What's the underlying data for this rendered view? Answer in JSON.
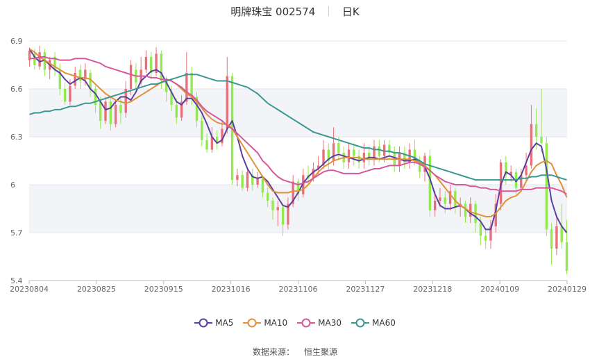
{
  "header": {
    "title": "明牌珠宝 002574",
    "period": "日K"
  },
  "source": {
    "label": "数据来源：",
    "value": "恒生聚源"
  },
  "chart_data": {
    "type": "candlestick",
    "y_ticks": [
      "6.9",
      "6.6",
      "6.3",
      "6",
      "5.7",
      "5.4"
    ],
    "y_range": [
      5.4,
      6.9
    ],
    "x_ticks": [
      "20230804",
      "20230825",
      "20230915",
      "20231016",
      "20231106",
      "20231127",
      "20231218",
      "20240109",
      "20240129"
    ],
    "grid": "horizontal, alternating shaded bands",
    "colors": {
      "up": "#e8707a",
      "down": "#92ea4e"
    },
    "legend_position": "bottom",
    "series": [
      {
        "name": "MA5",
        "color": "#5b3fa0",
        "values": [
          6.85,
          6.8,
          6.77,
          6.78,
          6.75,
          6.72,
          6.7,
          6.66,
          6.63,
          6.65,
          6.67,
          6.65,
          6.6,
          6.57,
          6.52,
          6.47,
          6.48,
          6.52,
          6.55,
          6.55,
          6.53,
          6.58,
          6.65,
          6.68,
          6.71,
          6.72,
          6.7,
          6.64,
          6.58,
          6.52,
          6.5,
          6.54,
          6.54,
          6.5,
          6.45,
          6.38,
          6.3,
          6.26,
          6.28,
          6.35,
          6.4,
          6.3,
          6.18,
          6.1,
          6.05,
          6.04,
          6.05,
          6.02,
          5.97,
          5.92,
          5.87,
          5.86,
          5.9,
          5.95,
          6.01,
          6.05,
          6.08,
          6.1,
          6.13,
          6.16,
          6.18,
          6.19,
          6.18,
          6.17,
          6.16,
          6.15,
          6.16,
          6.17,
          6.17,
          6.16,
          6.17,
          6.18,
          6.17,
          6.16,
          6.15,
          6.15,
          6.16,
          6.15,
          6.11,
          6.04,
          5.94,
          5.87,
          5.85,
          5.85,
          5.86,
          5.87,
          5.85,
          5.82,
          5.8,
          5.77,
          5.72,
          5.72,
          5.84,
          6.0,
          6.08,
          6.06,
          6.02,
          6.06,
          6.14,
          6.22,
          6.26,
          6.24,
          6.1,
          5.9,
          5.8,
          5.74,
          5.7
        ]
      },
      {
        "name": "MA10",
        "color": "#e0913a",
        "values": [
          6.85,
          6.83,
          6.8,
          6.78,
          6.76,
          6.74,
          6.72,
          6.7,
          6.69,
          6.68,
          6.67,
          6.67,
          6.66,
          6.63,
          6.6,
          6.57,
          6.55,
          6.53,
          6.52,
          6.51,
          6.52,
          6.54,
          6.56,
          6.58,
          6.6,
          6.62,
          6.64,
          6.66,
          6.65,
          6.63,
          6.6,
          6.57,
          6.55,
          6.52,
          6.48,
          6.44,
          6.41,
          6.39,
          6.38,
          6.38,
          6.35,
          6.3,
          6.25,
          6.2,
          6.15,
          6.1,
          6.05,
          6.0,
          5.96,
          5.95,
          5.95,
          5.95,
          5.96,
          5.96,
          5.97,
          6.0,
          6.04,
          6.08,
          6.11,
          6.13,
          6.15,
          6.16,
          6.17,
          6.17,
          6.17,
          6.17,
          6.16,
          6.16,
          6.16,
          6.16,
          6.16,
          6.16,
          6.16,
          6.16,
          6.16,
          6.16,
          6.15,
          6.14,
          6.12,
          6.09,
          6.06,
          6.02,
          5.98,
          5.94,
          5.9,
          5.87,
          5.85,
          5.83,
          5.82,
          5.81,
          5.8,
          5.8,
          5.82,
          5.86,
          5.9,
          5.92,
          5.93,
          5.96,
          6.02,
          6.08,
          6.12,
          6.14,
          6.15,
          6.13,
          6.06,
          6.0,
          5.92
        ]
      },
      {
        "name": "MA30",
        "color": "#d6579c",
        "values": [
          6.79,
          6.79,
          6.8,
          6.8,
          6.79,
          6.79,
          6.78,
          6.78,
          6.78,
          6.79,
          6.79,
          6.79,
          6.78,
          6.77,
          6.76,
          6.74,
          6.73,
          6.72,
          6.71,
          6.7,
          6.69,
          6.68,
          6.68,
          6.68,
          6.67,
          6.67,
          6.66,
          6.66,
          6.65,
          6.63,
          6.61,
          6.58,
          6.56,
          6.53,
          6.49,
          6.46,
          6.44,
          6.42,
          6.4,
          6.37,
          6.35,
          6.32,
          6.29,
          6.26,
          6.23,
          6.2,
          6.15,
          6.12,
          6.08,
          6.05,
          6.03,
          6.02,
          6.01,
          6.0,
          6.01,
          6.02,
          6.04,
          6.06,
          6.08,
          6.09,
          6.09,
          6.08,
          6.07,
          6.07,
          6.07,
          6.07,
          6.08,
          6.09,
          6.1,
          6.1,
          6.11,
          6.12,
          6.12,
          6.12,
          6.13,
          6.14,
          6.14,
          6.13,
          6.11,
          6.09,
          6.06,
          6.04,
          6.02,
          6.01,
          6.0,
          6.0,
          6.0,
          5.99,
          5.99,
          5.98,
          5.98,
          5.97,
          5.97,
          5.96,
          5.96,
          5.96,
          5.96,
          5.97,
          5.97,
          5.97,
          5.98,
          5.98,
          5.98,
          5.98,
          5.97,
          5.96,
          5.94
        ]
      },
      {
        "name": "MA60",
        "color": "#3a9793",
        "values": [
          6.44,
          6.45,
          6.45,
          6.46,
          6.46,
          6.47,
          6.47,
          6.48,
          6.49,
          6.49,
          6.5,
          6.51,
          6.51,
          6.52,
          6.53,
          6.54,
          6.55,
          6.56,
          6.57,
          6.58,
          6.59,
          6.6,
          6.61,
          6.62,
          6.63,
          6.63,
          6.64,
          6.65,
          6.66,
          6.67,
          6.68,
          6.69,
          6.69,
          6.69,
          6.68,
          6.67,
          6.66,
          6.65,
          6.65,
          6.65,
          6.64,
          6.63,
          6.62,
          6.61,
          6.59,
          6.57,
          6.54,
          6.51,
          6.49,
          6.47,
          6.45,
          6.43,
          6.41,
          6.39,
          6.37,
          6.35,
          6.33,
          6.32,
          6.31,
          6.3,
          6.29,
          6.28,
          6.27,
          6.26,
          6.25,
          6.24,
          6.23,
          6.23,
          6.22,
          6.22,
          6.21,
          6.21,
          6.2,
          6.2,
          6.19,
          6.18,
          6.17,
          6.15,
          6.13,
          6.12,
          6.11,
          6.1,
          6.09,
          6.08,
          6.07,
          6.06,
          6.05,
          6.04,
          6.03,
          6.03,
          6.03,
          6.03,
          6.03,
          6.03,
          6.03,
          6.03,
          6.03,
          6.04,
          6.04,
          6.05,
          6.05,
          6.06,
          6.06,
          6.06,
          6.05,
          6.04,
          6.03
        ]
      }
    ],
    "candles": [
      [
        6.78,
        6.84,
        6.86,
        6.74
      ],
      [
        6.82,
        6.75,
        6.85,
        6.72
      ],
      [
        6.74,
        6.83,
        6.87,
        6.72
      ],
      [
        6.83,
        6.72,
        6.85,
        6.68
      ],
      [
        6.72,
        6.78,
        6.8,
        6.66
      ],
      [
        6.8,
        6.72,
        6.83,
        6.68
      ],
      [
        6.72,
        6.6,
        6.76,
        6.56
      ],
      [
        6.6,
        6.52,
        6.64,
        6.5
      ],
      [
        6.52,
        6.62,
        6.66,
        6.5
      ],
      [
        6.62,
        6.7,
        6.74,
        6.6
      ],
      [
        6.72,
        6.65,
        6.75,
        6.6
      ],
      [
        6.66,
        6.72,
        6.76,
        6.62
      ],
      [
        6.7,
        6.6,
        6.72,
        6.55
      ],
      [
        6.6,
        6.5,
        6.62,
        6.45
      ],
      [
        6.52,
        6.4,
        6.55,
        6.35
      ],
      [
        6.4,
        6.52,
        6.55,
        6.38
      ],
      [
        6.52,
        6.38,
        6.55,
        6.34
      ],
      [
        6.38,
        6.5,
        6.53,
        6.36
      ],
      [
        6.5,
        6.45,
        6.55,
        6.38
      ],
      [
        6.45,
        6.6,
        6.65,
        6.42
      ],
      [
        6.6,
        6.75,
        6.78,
        6.56
      ],
      [
        6.72,
        6.64,
        6.76,
        6.6
      ],
      [
        6.64,
        6.72,
        6.8,
        6.62
      ],
      [
        6.72,
        6.8,
        6.84,
        6.7
      ],
      [
        6.8,
        6.7,
        6.83,
        6.66
      ],
      [
        6.7,
        6.82,
        6.86,
        6.68
      ],
      [
        6.82,
        6.65,
        6.84,
        6.6
      ],
      [
        6.65,
        6.58,
        6.68,
        6.52
      ],
      [
        6.58,
        6.5,
        6.62,
        6.46
      ],
      [
        6.5,
        6.42,
        6.54,
        6.38
      ],
      [
        6.42,
        6.52,
        6.56,
        6.4
      ],
      [
        6.52,
        6.7,
        6.83,
        6.5
      ],
      [
        6.7,
        6.55,
        6.74,
        6.5
      ],
      [
        6.55,
        6.4,
        6.58,
        6.36
      ],
      [
        6.4,
        6.28,
        6.44,
        6.24
      ],
      [
        6.28,
        6.22,
        6.32,
        6.2
      ],
      [
        6.22,
        6.3,
        6.36,
        6.2
      ],
      [
        6.3,
        6.26,
        6.34,
        6.22
      ],
      [
        6.26,
        6.35,
        6.4,
        6.24
      ],
      [
        6.35,
        6.68,
        6.8,
        6.32
      ],
      [
        6.68,
        6.03,
        6.7,
        6.0
      ],
      [
        6.03,
        6.06,
        6.1,
        5.99
      ],
      [
        6.06,
        5.98,
        6.09,
        5.96
      ],
      [
        5.98,
        6.08,
        6.1,
        5.96
      ],
      [
        6.06,
        6.0,
        6.1,
        5.96
      ],
      [
        6.0,
        6.04,
        6.08,
        5.98
      ],
      [
        6.04,
        5.95,
        6.06,
        5.92
      ],
      [
        5.95,
        5.9,
        5.98,
        5.86
      ],
      [
        5.9,
        5.84,
        5.92,
        5.78
      ],
      [
        5.84,
        5.86,
        5.9,
        5.74
      ],
      [
        5.86,
        5.75,
        5.88,
        5.68
      ],
      [
        5.75,
        5.88,
        5.92,
        5.72
      ],
      [
        5.88,
        6.02,
        6.06,
        5.86
      ],
      [
        6.02,
        5.94,
        6.04,
        5.9
      ],
      [
        5.94,
        6.06,
        6.1,
        5.92
      ],
      [
        6.06,
        6.04,
        6.12,
        6.0
      ],
      [
        6.04,
        6.1,
        6.14,
        6.02
      ],
      [
        6.1,
        6.12,
        6.18,
        6.06
      ],
      [
        6.12,
        6.22,
        6.28,
        6.1
      ],
      [
        6.22,
        6.15,
        6.26,
        6.1
      ],
      [
        6.15,
        6.26,
        6.36,
        6.12
      ],
      [
        6.26,
        6.2,
        6.3,
        6.16
      ],
      [
        6.2,
        6.14,
        6.24,
        6.1
      ],
      [
        6.14,
        6.22,
        6.26,
        6.1
      ],
      [
        6.22,
        6.18,
        6.26,
        6.12
      ],
      [
        6.18,
        6.14,
        6.22,
        6.1
      ],
      [
        6.14,
        6.2,
        6.26,
        6.1
      ],
      [
        6.2,
        6.16,
        6.24,
        6.12
      ],
      [
        6.16,
        6.24,
        6.28,
        6.12
      ],
      [
        6.24,
        6.18,
        6.28,
        6.14
      ],
      [
        6.18,
        6.25,
        6.28,
        6.14
      ],
      [
        6.25,
        6.2,
        6.28,
        6.16
      ],
      [
        6.2,
        6.12,
        6.24,
        6.08
      ],
      [
        6.12,
        6.2,
        6.24,
        6.08
      ],
      [
        6.2,
        6.14,
        6.24,
        6.1
      ],
      [
        6.14,
        6.22,
        6.26,
        6.1
      ],
      [
        6.22,
        6.15,
        6.28,
        6.12
      ],
      [
        6.15,
        6.08,
        6.18,
        6.04
      ],
      [
        6.08,
        6.18,
        6.2,
        6.02
      ],
      [
        6.18,
        5.84,
        6.22,
        5.8
      ],
      [
        5.84,
        5.9,
        5.96,
        5.8
      ],
      [
        5.9,
        5.92,
        5.98,
        5.86
      ],
      [
        5.92,
        5.88,
        5.96,
        5.82
      ],
      [
        5.88,
        5.96,
        6.0,
        5.84
      ],
      [
        5.96,
        5.86,
        5.98,
        5.82
      ],
      [
        5.86,
        5.88,
        5.92,
        5.8
      ],
      [
        5.88,
        5.8,
        5.9,
        5.76
      ],
      [
        5.8,
        5.88,
        5.92,
        5.76
      ],
      [
        5.88,
        5.76,
        5.9,
        5.7
      ],
      [
        5.76,
        5.68,
        5.8,
        5.62
      ],
      [
        5.68,
        5.65,
        5.72,
        5.6
      ],
      [
        5.65,
        5.74,
        5.78,
        5.6
      ],
      [
        5.74,
        5.88,
        5.94,
        5.7
      ],
      [
        5.88,
        6.14,
        6.16,
        5.84
      ],
      [
        6.14,
        6.06,
        6.18,
        6.0
      ],
      [
        6.06,
        6.08,
        6.12,
        6.02
      ],
      [
        6.08,
        5.98,
        6.1,
        5.94
      ],
      [
        5.98,
        6.06,
        6.1,
        5.96
      ],
      [
        6.06,
        6.12,
        6.2,
        6.02
      ],
      [
        6.12,
        6.38,
        6.5,
        6.1
      ],
      [
        6.38,
        6.3,
        6.48,
        6.22
      ],
      [
        6.3,
        6.26,
        6.6,
        6.2
      ],
      [
        6.26,
        5.72,
        6.3,
        5.68
      ],
      [
        5.72,
        5.6,
        5.76,
        5.5
      ],
      [
        5.6,
        5.74,
        5.8,
        5.56
      ],
      [
        5.74,
        5.64,
        5.88,
        5.6
      ],
      [
        5.64,
        5.46,
        5.78,
        5.44
      ]
    ]
  }
}
